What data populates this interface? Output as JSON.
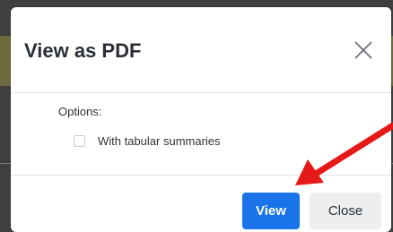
{
  "modal": {
    "title": "View as PDF",
    "options_label": "Options:",
    "checkbox_label": "With tabular summaries",
    "checkbox_checked": false,
    "view_button": "View",
    "close_button": "Close",
    "close_icon": "close-x-icon",
    "accent_color": "#1a73e8"
  },
  "annotation": {
    "type": "arrow",
    "color": "#e61919",
    "points_to": "view-button"
  }
}
